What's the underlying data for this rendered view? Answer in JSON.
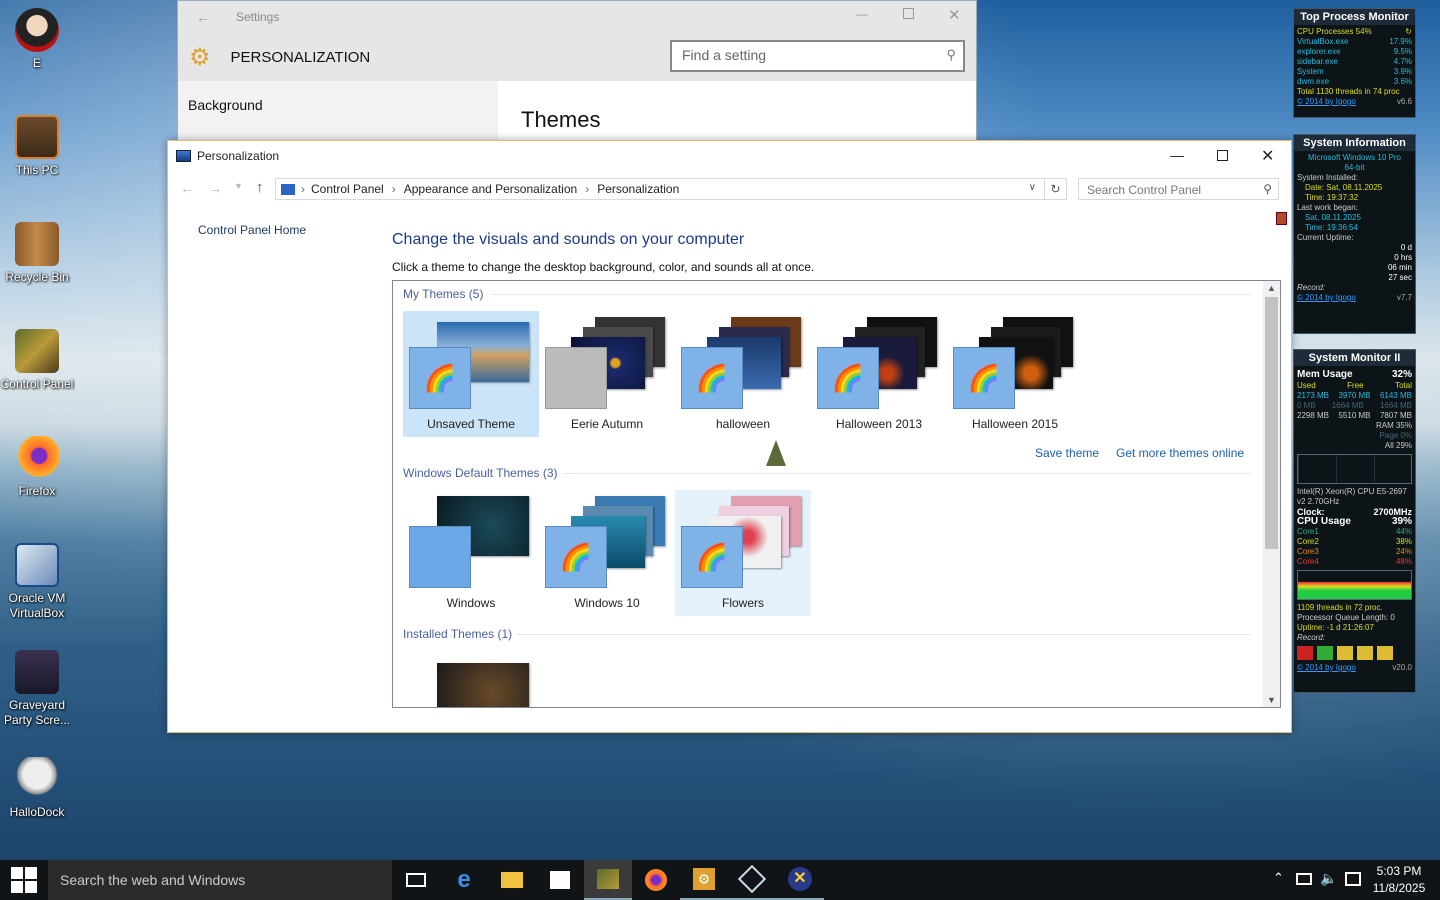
{
  "desktop": {
    "icons": [
      {
        "label": "E",
        "icon": "vampire-icon"
      },
      {
        "label": "This PC",
        "icon": "pumpkin-pc-icon"
      },
      {
        "label": "Recycle Bin",
        "icon": "recycle-bin-icon"
      },
      {
        "label": "Control Panel",
        "icon": "control-panel-icon"
      },
      {
        "label": "Firefox",
        "icon": "firefox-icon"
      },
      {
        "label": "Oracle VM VirtualBox",
        "icon": "virtualbox-icon"
      },
      {
        "label": "Graveyard Party Scre...",
        "icon": "graveyard-icon"
      },
      {
        "label": "HalloDock",
        "icon": "skull-icon"
      }
    ]
  },
  "settings_window": {
    "title": "Settings",
    "header": "PERSONALIZATION",
    "search_placeholder": "Find a setting",
    "nav_item": "Background",
    "page_heading": "Themes"
  },
  "control_panel": {
    "title": "Personalization",
    "breadcrumb": [
      "Control Panel",
      "Appearance and Personalization",
      "Personalization"
    ],
    "search_placeholder": "Search Control Panel",
    "sidebar_link": "Control Panel Home",
    "heading": "Change the visuals and sounds on your computer",
    "subheading": "Click a theme to change the desktop background, color, and sounds all at once.",
    "sections": {
      "my_themes": "My Themes (5)",
      "default_themes": "Windows Default Themes (3)",
      "installed_themes": "Installed Themes (1)"
    },
    "my_themes": [
      "Unsaved Theme",
      "Eerie Autumn",
      "halloween",
      "Halloween 2013",
      "Halloween 2015"
    ],
    "default_themes": [
      "Windows",
      "Windows 10",
      "Flowers"
    ],
    "links": {
      "save": "Save theme",
      "more": "Get more themes online"
    }
  },
  "gadgets": {
    "top_process": {
      "title": "Top Process Monitor",
      "rows": [
        [
          "CPU Processes 54%",
          ""
        ],
        [
          "VirtualBox.exe",
          "17.9%"
        ],
        [
          "explorer.exe",
          "9.5%"
        ],
        [
          "sidebar.exe",
          "4.7%"
        ],
        [
          "System",
          "3.9%"
        ],
        [
          "dwm.exe",
          "3.6%"
        ]
      ],
      "footer": "Total 1130 threads in 74 proc",
      "credit": "© 2014 by Igogo",
      "version": "v6.6"
    },
    "system_info": {
      "title": "System Information",
      "lines": [
        "Microsoft Windows 10 Pro",
        "64-bit",
        "System Installed:",
        "Date: Sat, 08.11.2025",
        "Time: 19:37:32",
        "Last work began:",
        "Sat, 08.11.2025",
        "Time: 19:36:54",
        "Current Uptime:"
      ],
      "uptime": [
        "0 d",
        "0 hrs",
        "06 min",
        "27 sec"
      ],
      "record": "Record:",
      "credit": "© 2014 by Igogo",
      "version": "v7.7"
    },
    "system_monitor": {
      "title": "System Monitor II",
      "mem_label": "Mem Usage",
      "mem_pct": "32%",
      "mem_cols": [
        "Used",
        "Free",
        "Total"
      ],
      "mem_row1": [
        "2173 MB",
        "3970 MB",
        "6143 MB"
      ],
      "mem_row2": [
        "0 MB",
        "1664 MB",
        "1664 MB"
      ],
      "mem_row3": [
        "2298 MB",
        "5510 MB",
        "7807 MB"
      ],
      "ram": "RAM 35%",
      "page": "Page 0%",
      "all": "All 29%",
      "cpu_name": "Intel(R) Xeon(R) CPU E5-2697 v2 2.70GHz",
      "clock_label": "Clock:",
      "clock": "2700MHz",
      "cpu_label": "CPU Usage",
      "cpu_pct": "39%",
      "cores": [
        [
          "Core1",
          "44%"
        ],
        [
          "Core2",
          "38%"
        ],
        [
          "Core3",
          "24%"
        ],
        [
          "Core4",
          "48%"
        ]
      ],
      "threads": "1109 threads in 72 proc.",
      "queue": "Processor Queue Length: 0",
      "uptime": "Uptime: -1 d 21:26:07",
      "record": "Record:",
      "credit": "© 2014 by Igogo",
      "version": "v20.0"
    }
  },
  "taskbar": {
    "search_text": "Search the web and Windows",
    "time": "5:03 PM",
    "date": "11/8/2025"
  }
}
